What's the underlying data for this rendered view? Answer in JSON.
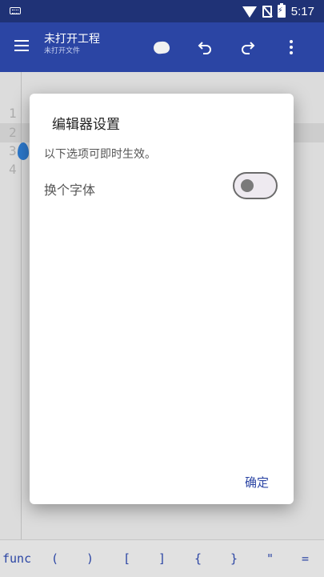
{
  "status_bar": {
    "time": "5:17",
    "icons": [
      "keyboard-icon",
      "wifi-icon",
      "no-sim-icon",
      "battery-charging-icon"
    ]
  },
  "app_bar": {
    "title": "未打开工程",
    "subtitle": "未打开文件",
    "icons": [
      "menu-icon",
      "run-icon",
      "undo-icon",
      "redo-icon",
      "more-vert-icon"
    ]
  },
  "editor": {
    "line_numbers": [
      "1",
      "2",
      "3",
      "4"
    ]
  },
  "symbols_bar": {
    "items": [
      "func",
      "(",
      ")",
      "[",
      "]",
      "{",
      "}",
      "\"",
      "="
    ]
  },
  "dialog": {
    "title": "编辑器设置",
    "description": "以下选项可即时生效。",
    "option_label": "换个字体",
    "option_value": false,
    "ok_label": "确定"
  },
  "colors": {
    "primary": "#2b45a4",
    "status_bar": "#1f3276"
  }
}
